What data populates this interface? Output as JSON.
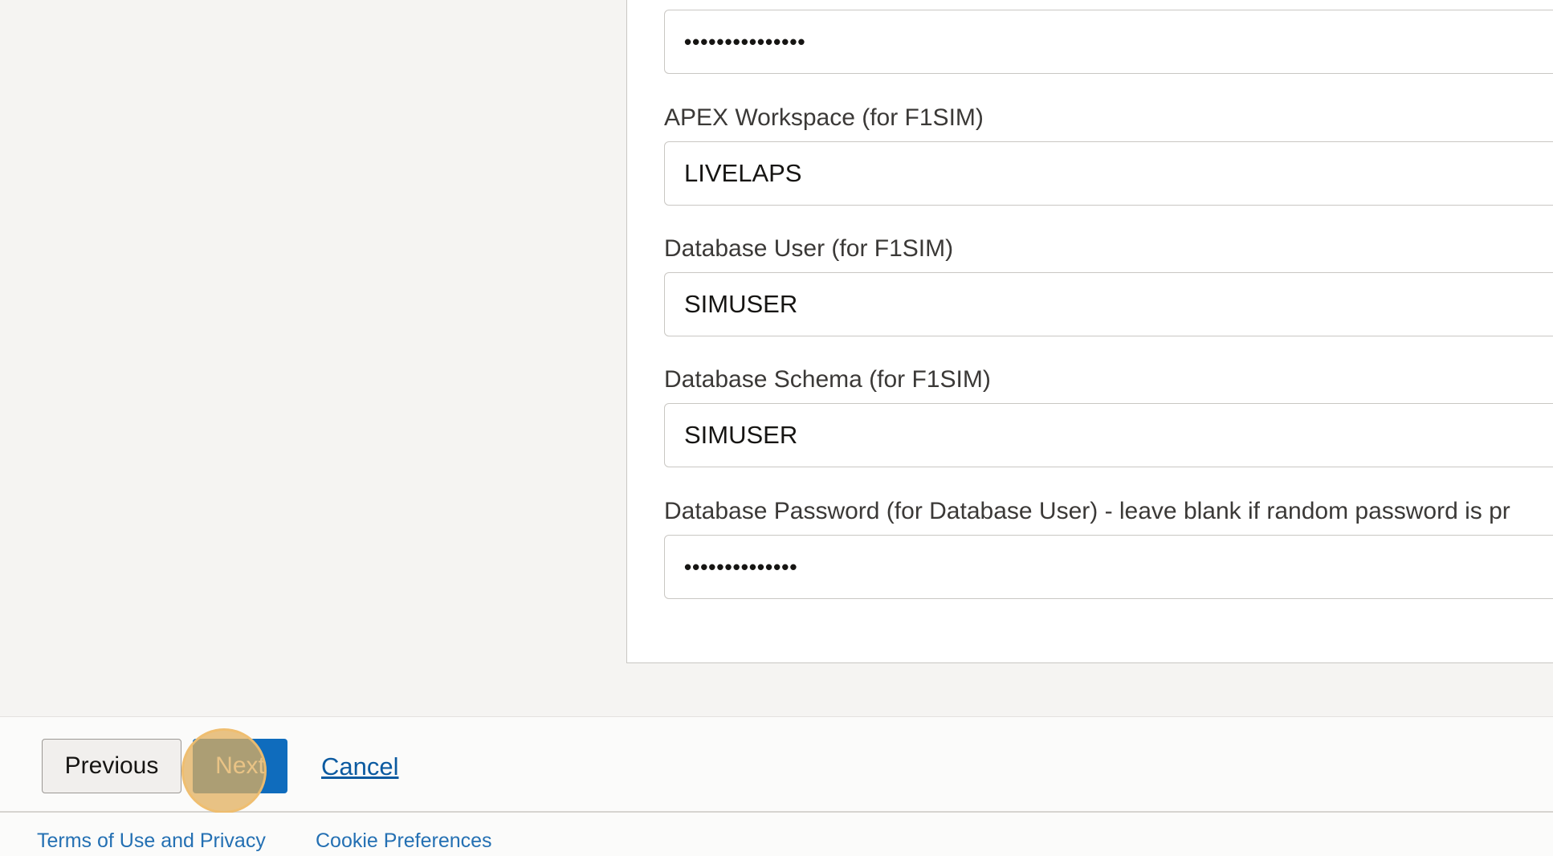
{
  "form": {
    "fields": [
      {
        "label": "",
        "value": "•••••••••••••••",
        "type": "password"
      },
      {
        "label": "APEX Workspace (for F1SIM)",
        "value": "LIVELAPS",
        "type": "text"
      },
      {
        "label": "Database User (for F1SIM)",
        "value": "SIMUSER",
        "type": "text"
      },
      {
        "label": "Database Schema (for F1SIM)",
        "value": "SIMUSER",
        "type": "text"
      },
      {
        "label": "Database Password (for Database User) - leave blank if random password is pr",
        "value": "••••••••••••••",
        "type": "password"
      }
    ]
  },
  "navigation": {
    "previous_label": "Previous",
    "next_label": "Next",
    "cancel_label": "Cancel"
  },
  "footer": {
    "terms_label": "Terms of Use and Privacy",
    "cookie_label": "Cookie Preferences"
  },
  "colors": {
    "primary_button": "#0f6cbd",
    "link": "#0b5aa0",
    "click_marker": "#e2af5c"
  }
}
